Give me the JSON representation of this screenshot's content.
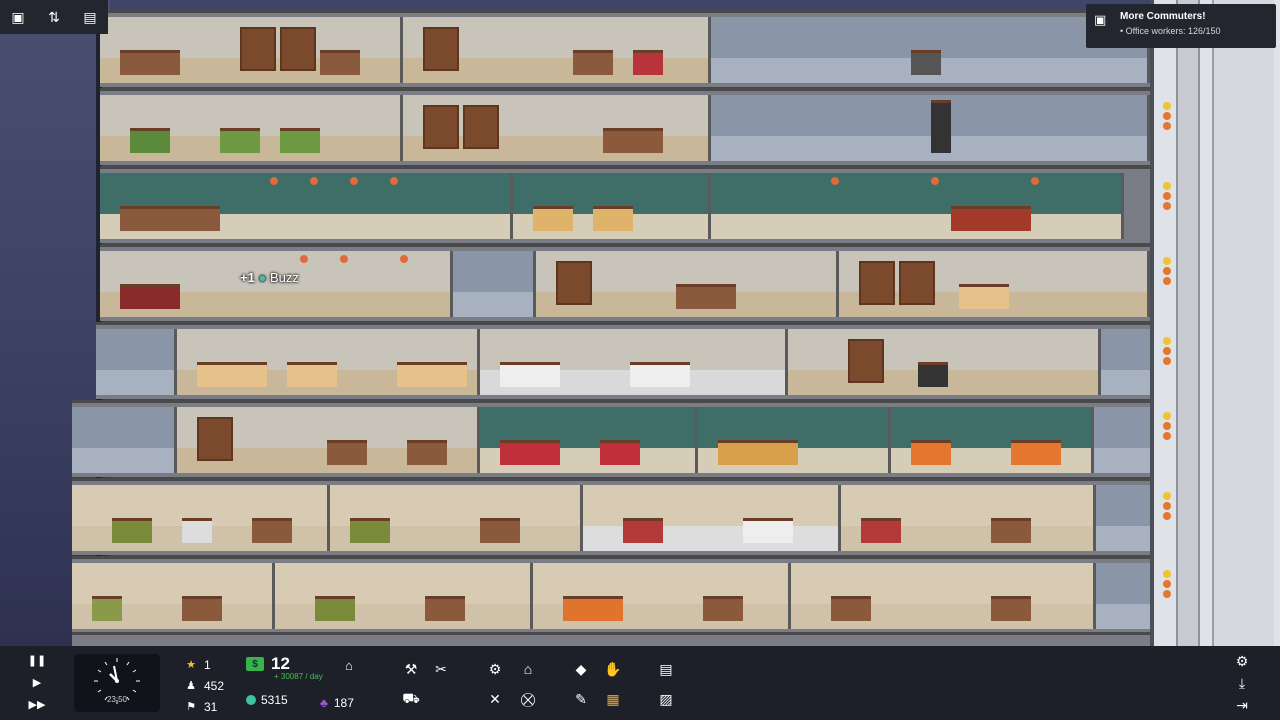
{
  "top_bar": {
    "icons": [
      "windows-icon",
      "stats-icon",
      "list-icon"
    ]
  },
  "notification": {
    "title": "More Commuters!",
    "subtitle": "• Office workers: 126/150"
  },
  "floating_tag": {
    "amount": "+1",
    "name": "Buzz"
  },
  "hud": {
    "clock_time": "23:50",
    "star_rating": "1",
    "population": "452",
    "residents": "31",
    "money": "12",
    "money_rate": "+ 30087 / day",
    "tokens": "5315",
    "influence": "187"
  },
  "colors": {
    "hud_bg": "#1e2029",
    "money_green": "#37b34a",
    "star_yellow": "#f2c230",
    "highlight_orange": "#f2a52a",
    "influence_purple": "#9a5ad6"
  }
}
